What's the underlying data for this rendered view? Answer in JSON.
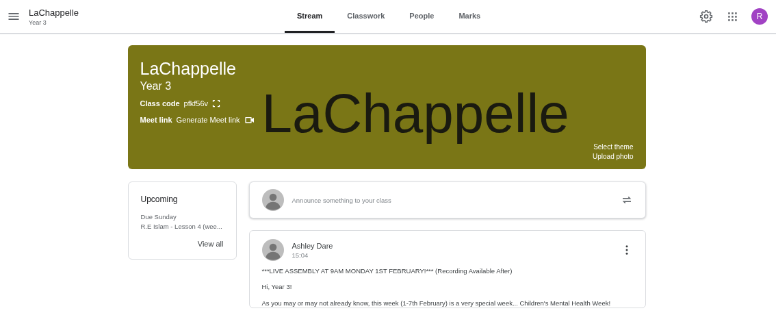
{
  "header": {
    "class_name": "LaChappelle",
    "section": "Year 3"
  },
  "tabs": [
    {
      "label": "Stream",
      "selected": true
    },
    {
      "label": "Classwork",
      "selected": false
    },
    {
      "label": "People",
      "selected": false
    },
    {
      "label": "Marks",
      "selected": false
    }
  ],
  "account": {
    "initial": "R"
  },
  "banner": {
    "art_text": "LaChappelle",
    "title": "LaChappelle",
    "subtitle": "Year 3",
    "class_code_label": "Class code",
    "class_code": "pfkf56v",
    "meet_label": "Meet link",
    "meet_action": "Generate Meet link",
    "links": [
      "Select theme",
      "Upload photo"
    ]
  },
  "upcoming": {
    "title": "Upcoming",
    "due": "Due Sunday",
    "item": "R.E Islam - Lesson 4 (wee...",
    "link": "View all"
  },
  "composer": {
    "placeholder": "Announce something to your class"
  },
  "posts": [
    {
      "author": "Ashley Dare",
      "time": "15:04",
      "paragraphs": [
        "***LIVE ASSEMBLY AT 9AM MONDAY 1ST FEBRUARY!*** (Recording Available After)",
        "Hi, Year 3!",
        "As you may or may not already know, this week (1-7th February) is a very special week... Children's Mental Health Week!"
      ]
    }
  ]
}
